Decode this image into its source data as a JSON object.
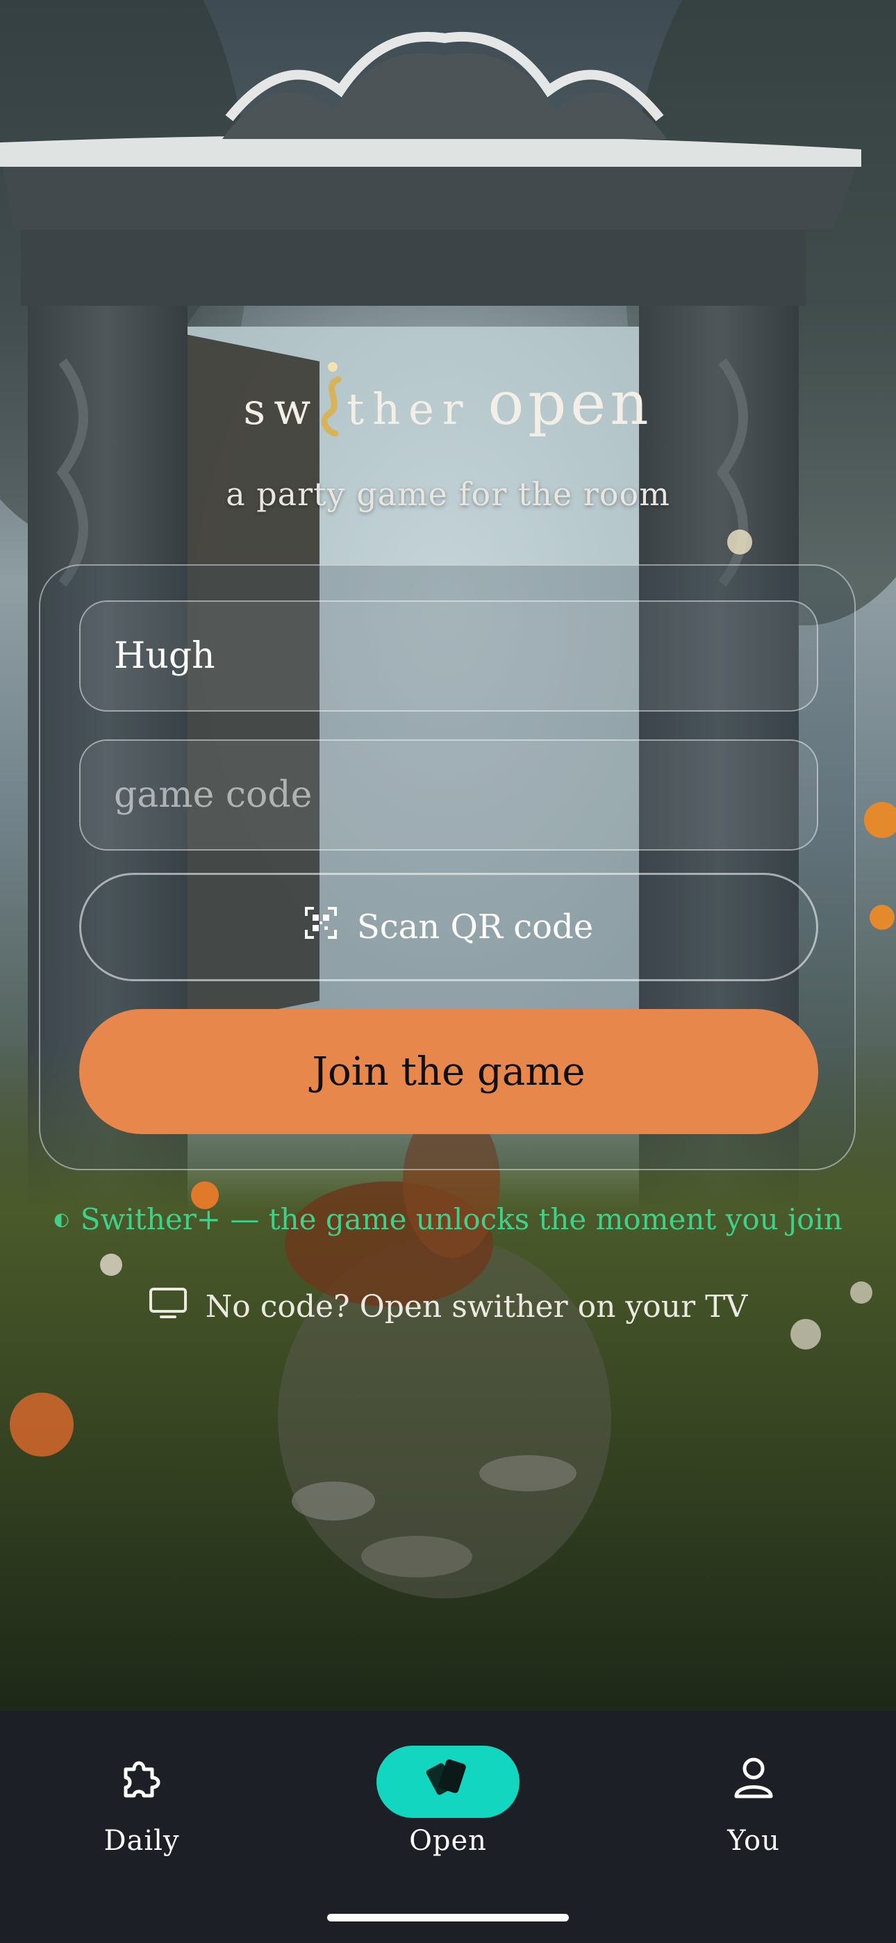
{
  "brand": {
    "word_a": "swither",
    "word_b": "open",
    "tagline": "a party game for the room"
  },
  "form": {
    "name_value": "Hugh",
    "code_placeholder": "game code",
    "scan_label": "Scan QR code",
    "join_label": "Join the game"
  },
  "notes": {
    "plus_text": "Swither+ — the game unlocks the moment you join",
    "tv_text": "No code? Open swither on your TV"
  },
  "nav": {
    "items": [
      {
        "label": "Daily",
        "icon": "puzzle-icon"
      },
      {
        "label": "Open",
        "icon": "cards-icon"
      },
      {
        "label": "You",
        "icon": "person-icon"
      }
    ],
    "active": "Open"
  },
  "colors": {
    "accent_orange": "#e8874b",
    "active_tab": "#13d6c0",
    "plus_green": "#3fd08a",
    "nav_bg": "#1d1f26"
  }
}
